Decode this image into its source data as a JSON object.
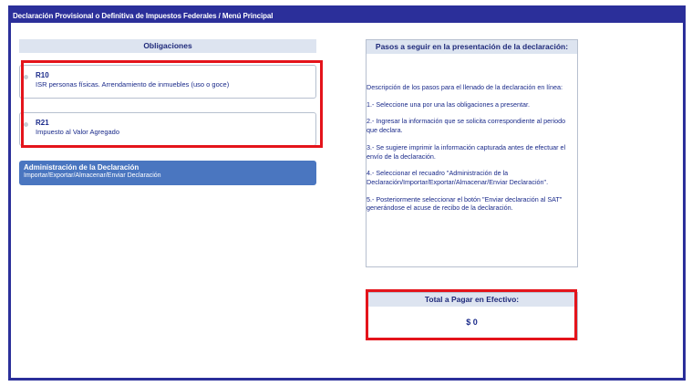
{
  "title_bar": "Declaración Provisional o Definitiva de Impuestos Federales / Menú Principal",
  "obligations": {
    "header": "Obligaciones",
    "items": [
      {
        "code": "R10",
        "description": "ISR personas físicas. Arrendamiento de inmuebles (uso o goce)"
      },
      {
        "code": "R21",
        "description": "Impuesto al Valor Agregado"
      }
    ]
  },
  "admin_button": {
    "title": "Administración de la Declaración",
    "subtitle": "Importar/Exportar/Almacenar/Enviar Declaración"
  },
  "steps": {
    "header": "Pasos a seguir en la presentación de la declaración:",
    "paragraphs": [
      "Descripción de los pasos para el llenado de la declaración en línea:",
      "1.- Seleccione una por una las obligaciones a presentar.",
      "2.- Ingresar la información que se solicita correspondiente al periodo que declara.",
      "3.- Se sugiere imprimir la información capturada antes de efectuar el envío de la declaración.",
      "4.- Seleccionar el recuadro \"Administración de la Declaración/Importar/Exportar/Almacenar/Enviar Declaración\".",
      "5.- Posteriormente seleccionar el botón \"Enviar declaración al SAT\" generándose el acuse de recibo de la declaración."
    ]
  },
  "total": {
    "header": "Total a Pagar en Efectivo:",
    "value": "$ 0"
  },
  "colors": {
    "frame": "#2b2f9a",
    "highlight": "#e4141b",
    "admin_button": "#4a76c0",
    "section_header": "#dde4f0"
  }
}
